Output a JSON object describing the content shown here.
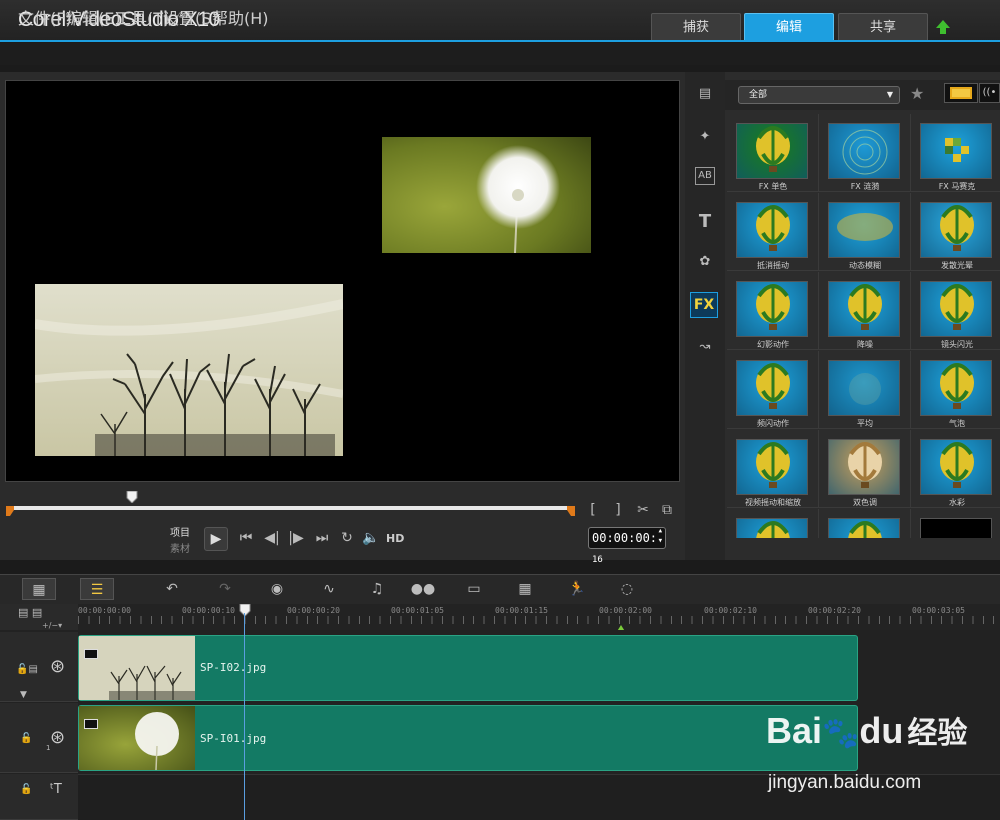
{
  "app": {
    "brand": "Corel",
    "product": "VideoStudio",
    "version": "X10"
  },
  "top_tabs": [
    {
      "label": "捕获",
      "active": false
    },
    {
      "label": "编辑",
      "active": true
    },
    {
      "label": "共享",
      "active": false
    }
  ],
  "menu": [
    "文件(F)",
    "编辑(E)",
    "工具(T)",
    "设置(S)",
    "帮助(H)"
  ],
  "preview": {
    "mode_project": "项目",
    "mode_clip": "素材",
    "timecode": "00:00:00:",
    "timecode_frame": "16",
    "hd_label": "HD",
    "scrub_position_fraction": 0.22
  },
  "library": {
    "filter_selected": "全部",
    "category": "FX",
    "tiles": [
      {
        "label": "FX 单色",
        "color": "#1a7f1a"
      },
      {
        "label": "FX 涟漪",
        "color": "#1e9ad6"
      },
      {
        "label": "FX 马赛克",
        "color": "#1ea2dc"
      },
      {
        "label": "抵消摇动",
        "color": "#1ea2dc"
      },
      {
        "label": "动态模糊",
        "color": "#1ea2dc"
      },
      {
        "label": "发散光晕",
        "color": "#2aa9e0"
      },
      {
        "label": "幻影动作",
        "color": "#1ea2dc"
      },
      {
        "label": "降噪",
        "color": "#1ea2dc"
      },
      {
        "label": "镜头闪光",
        "color": "#1ea2dc"
      },
      {
        "label": "频闪动作",
        "color": "#1ea2dc"
      },
      {
        "label": "平均",
        "color": "#1e96cc"
      },
      {
        "label": "气泡",
        "color": "#1ea2dc"
      },
      {
        "label": "视频摇动和缩放",
        "color": "#1ea2dc"
      },
      {
        "label": "双色调",
        "color": "#c8a05c"
      },
      {
        "label": "水彩",
        "color": "#1ea2dc"
      }
    ]
  },
  "timeline": {
    "ruler": [
      "00:00:00:00",
      "00:00:00:10",
      "00:00:00:20",
      "00:00:01:05",
      "00:00:01:15",
      "00:00:02:00",
      "00:00:02:10",
      "00:00:02:20",
      "00:00:03:05"
    ],
    "tracks": [
      {
        "clip_name": "SP-I02.jpg",
        "thumb": "trees"
      },
      {
        "clip_name": "SP-I01.jpg",
        "thumb": "dandelion"
      }
    ],
    "track_number": "1"
  },
  "watermark": {
    "brand": "Bai",
    "brand2": "du",
    "cn": "经验",
    "url": "jingyan.baidu.com"
  }
}
